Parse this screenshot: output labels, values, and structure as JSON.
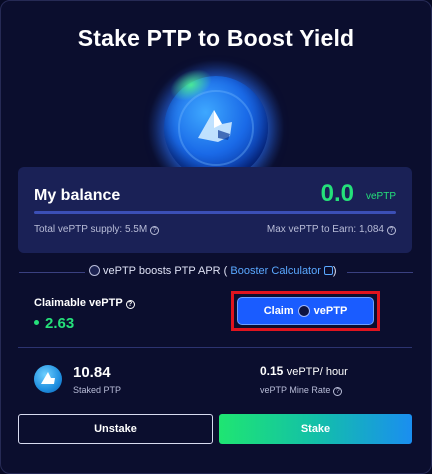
{
  "header": {
    "title": "Stake PTP to Boost Yield"
  },
  "balance": {
    "label": "My balance",
    "value": "0.0",
    "unit": "vePTP",
    "progress_fraction": 0.0,
    "supply_text": "Total vePTP supply: 5.5M",
    "max_text": "Max vePTP to Earn: 1,084"
  },
  "boost": {
    "text_prefix": "vePTP boosts PTP APR",
    "paren_open": "(",
    "link_text": "Booster Calculator",
    "paren_close": ")"
  },
  "claim": {
    "label": "Claimable vePTP",
    "value": "2.63",
    "button_word": "Claim",
    "button_unit": "vePTP"
  },
  "staked": {
    "value": "10.84",
    "label": "Staked PTP"
  },
  "mine_rate": {
    "value": "0.15",
    "unit": "vePTP/ hour",
    "label": "vePTP Mine Rate"
  },
  "actions": {
    "unstake_label": "Unstake",
    "stake_label": "Stake"
  },
  "icons": {
    "orb": "platypus-logo-orb-icon",
    "info": "info-icon",
    "coin": "veptp-coin-icon",
    "calculator": "calculator-icon",
    "ptp": "ptp-token-icon"
  },
  "colors": {
    "accent_green": "#25e07a",
    "primary_blue": "#1a5cff",
    "highlight_red": "#e0141e",
    "link_blue": "#5aa8ff"
  }
}
